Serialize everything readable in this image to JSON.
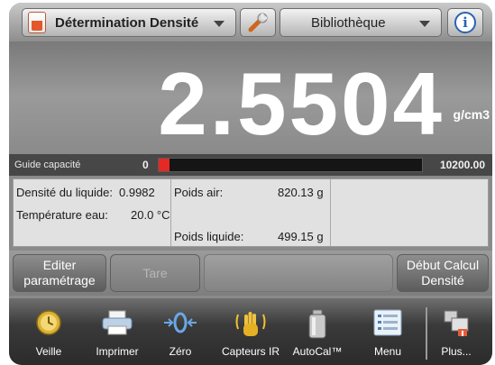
{
  "header": {
    "app_title": "Détermination Densité",
    "library_label": "Bibliothèque"
  },
  "reading": {
    "value": "2.5504",
    "unit": "g/cm3"
  },
  "capacity": {
    "label": "Guide capacité",
    "min": "0",
    "max": "10200.00",
    "fill_percent": 4,
    "fill_color": "#e42a22"
  },
  "panel": {
    "density_liquid_label": "Densité du liquide:",
    "density_liquid_value": "0.9982",
    "water_temp_label": "Température eau:",
    "water_temp_value": "20.0 °C",
    "weight_air_label": "Poids air:",
    "weight_air_value": "820.13 g",
    "weight_liquid_label": "Poids liquide:",
    "weight_liquid_value": "499.15 g"
  },
  "actions": {
    "edit_params_line1": "Editer",
    "edit_params_line2": "paramétrage",
    "tare": "Tare",
    "start_calc_line1": "Début Calcul",
    "start_calc_line2": "Densité"
  },
  "toolbar": {
    "items": [
      {
        "label": "Veille",
        "icon": "standby-icon"
      },
      {
        "label": "Imprimer",
        "icon": "printer-icon"
      },
      {
        "label": "Zéro",
        "icon": "zero-icon"
      },
      {
        "label": "Capteurs IR",
        "icon": "ir-sensor-hand-icon"
      },
      {
        "label": "AutoCal™",
        "icon": "autocal-weight-icon"
      },
      {
        "label": "Menu",
        "icon": "menu-list-icon"
      },
      {
        "label": "Plus...",
        "icon": "more-icon"
      }
    ]
  },
  "colors": {
    "accent_red": "#e42a22",
    "info_blue": "#2a63b3",
    "app_icon_orange": "#e2582c"
  }
}
